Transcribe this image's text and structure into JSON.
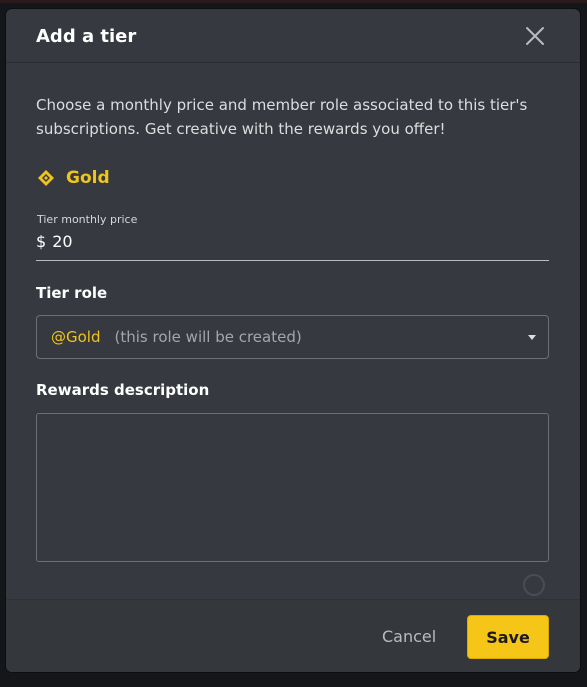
{
  "modal": {
    "title": "Add a tier",
    "description": "Choose a monthly price and member role associated to this tier's subscriptions. Get creative with the rewards you offer!",
    "tier_name": "Gold",
    "price": {
      "label": "Tier monthly price",
      "currency": "$",
      "value": "20"
    },
    "role": {
      "label": "Tier role",
      "selected": "@Gold",
      "hint": "(this role will be created)"
    },
    "rewards": {
      "label": "Rewards description",
      "value": ""
    },
    "footer": {
      "cancel_label": "Cancel",
      "save_label": "Save"
    }
  },
  "colors": {
    "accent": "#f0c419",
    "background": "#36393f",
    "save_button": "#f5c518"
  },
  "icons": [
    "close-icon",
    "gold-diamond-icon",
    "chevron-down-icon",
    "circle-indicator-icon"
  ]
}
